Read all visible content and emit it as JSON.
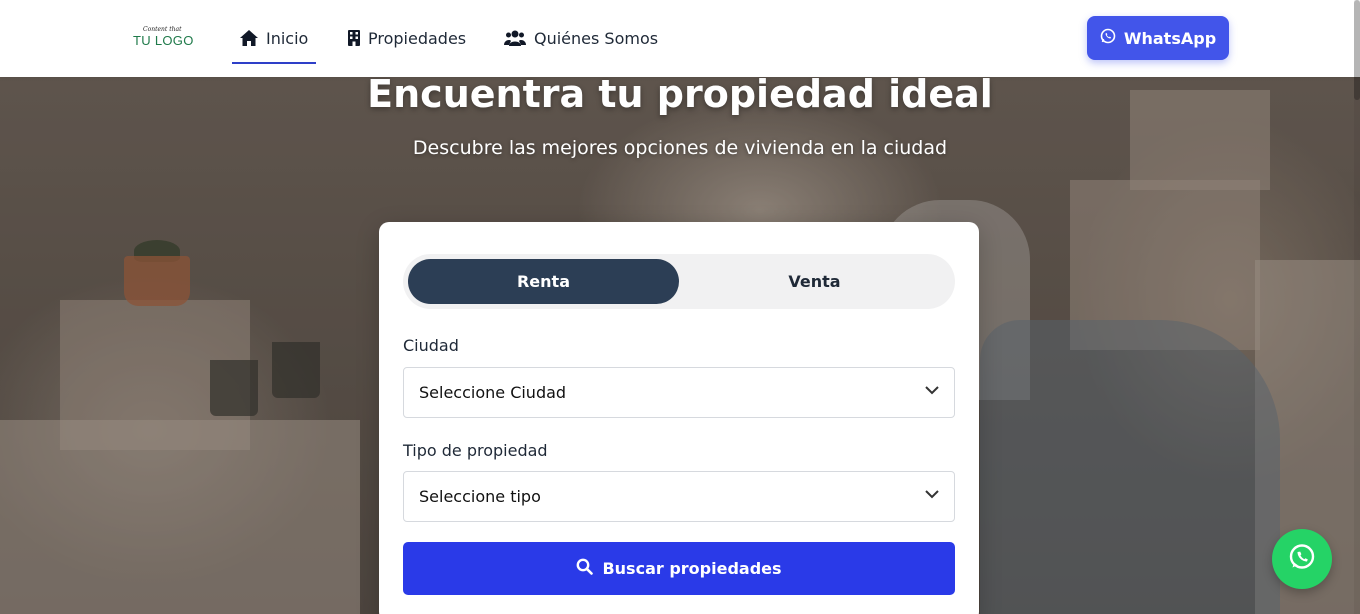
{
  "logo": {
    "tagline": "Content that",
    "name": "TU LOGO"
  },
  "nav": {
    "items": [
      {
        "label": "Inicio",
        "icon": "home-icon",
        "active": true
      },
      {
        "label": "Propiedades",
        "icon": "building-icon",
        "active": false
      },
      {
        "label": "Quiénes Somos",
        "icon": "users-icon",
        "active": false
      }
    ],
    "whatsapp_label": "WhatsApp"
  },
  "hero": {
    "title": "Encuentra tu propiedad ideal",
    "subtitle": "Descubre las mejores opciones de vivienda en la ciudad"
  },
  "search": {
    "tabs": [
      {
        "label": "Renta",
        "active": true
      },
      {
        "label": "Venta",
        "active": false
      }
    ],
    "city_label": "Ciudad",
    "city_value": "Seleccione Ciudad",
    "type_label": "Tipo de propiedad",
    "type_value": "Seleccione tipo",
    "button_label": "Buscar propiedades"
  },
  "colors": {
    "accent": "#2a3ae8",
    "whatsapp_button": "#4255ea",
    "active_tab": "#2c3e55",
    "whatsapp_float": "#25d366"
  }
}
